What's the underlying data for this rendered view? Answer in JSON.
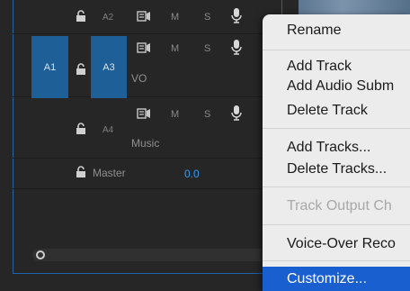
{
  "tracks": {
    "a2": {
      "label": "A2",
      "m": "M",
      "s": "S"
    },
    "vo": {
      "source": "A1",
      "label": "A3",
      "m": "M",
      "s": "S",
      "name": "VO"
    },
    "music": {
      "label": "A4",
      "m": "M",
      "s": "S",
      "name": "Music"
    },
    "master": {
      "name": "Master",
      "value": "0.0"
    }
  },
  "menu": {
    "items": [
      {
        "label": "Rename",
        "enabled": true
      },
      {
        "label": "Add Track",
        "enabled": true
      },
      {
        "label": "Add Audio Subm",
        "enabled": true
      },
      {
        "label": "Delete Track",
        "enabled": true
      },
      {
        "label": "Add Tracks...",
        "enabled": true
      },
      {
        "label": "Delete Tracks...",
        "enabled": true
      },
      {
        "label": "Track Output Ch",
        "enabled": false
      },
      {
        "label": "Voice-Over Reco",
        "enabled": true
      },
      {
        "label": "Customize...",
        "enabled": true,
        "selected": true
      }
    ]
  },
  "colors": {
    "track_target_blue": "#1e5f97",
    "menu_highlight": "#1a5fcf",
    "value_blue": "#3b9cf0"
  }
}
